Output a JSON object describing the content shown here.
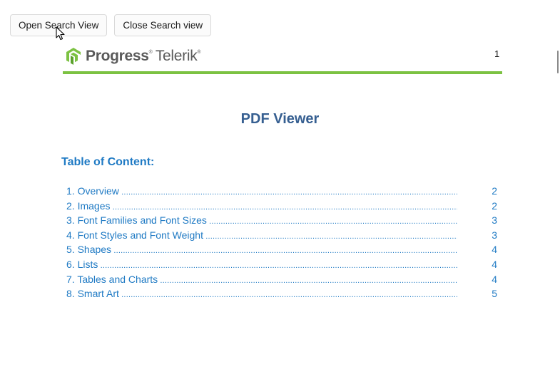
{
  "toolbar": {
    "open_label": "Open Search View",
    "close_label": "Close Search view"
  },
  "document": {
    "logo": {
      "brand": "Progress",
      "product": "Telerik",
      "registered": "®"
    },
    "page_number": "1",
    "title": "PDF Viewer",
    "toc_heading": "Table of Content:",
    "toc": [
      {
        "label": "1. Overview",
        "page": "2"
      },
      {
        "label": "2. Images",
        "page": "2"
      },
      {
        "label": "3. Font Families and Font Sizes",
        "page": "3"
      },
      {
        "label": "4. Font Styles and Font Weight",
        "page": "3"
      },
      {
        "label": "5. Shapes",
        "page": "4"
      },
      {
        "label": "6. Lists",
        "page": "4"
      },
      {
        "label": "7. Tables and Charts",
        "page": "4"
      },
      {
        "label": "8. Smart Art",
        "page": "5"
      }
    ]
  },
  "colors": {
    "accent_green": "#7cc242",
    "title_blue": "#365f91",
    "link_blue": "#1f7ac4"
  },
  "icons": {
    "cursor": "mouse-pointer-icon",
    "logo": "progress-logo-icon"
  }
}
